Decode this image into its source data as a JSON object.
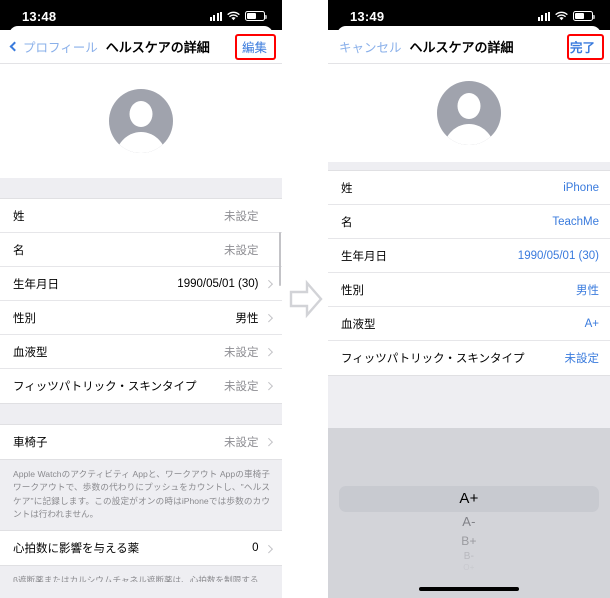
{
  "left_phone": {
    "status": {
      "time": "13:48",
      "cellular_icon": "signal-bars-icon",
      "wifi_icon": "wifi-icon",
      "battery_icon": "battery-icon"
    },
    "nav": {
      "back_label": "プロフィール",
      "title": "ヘルスケアの詳細",
      "action_label": "編集",
      "highlight_color": "#ff0000"
    },
    "avatar": "person-avatar-icon",
    "sections": [
      {
        "rows": [
          {
            "label": "姓",
            "value": "未設定",
            "value_style": "muted",
            "chevron": false
          },
          {
            "label": "名",
            "value": "未設定",
            "value_style": "muted",
            "chevron": false
          },
          {
            "label": "生年月日",
            "value": "1990/05/01 (30)",
            "value_style": "dark",
            "chevron": true
          },
          {
            "label": "性別",
            "value": "男性",
            "value_style": "dark",
            "chevron": true
          },
          {
            "label": "血液型",
            "value": "未設定",
            "value_style": "muted",
            "chevron": true
          },
          {
            "label": "フィッツパトリック・スキンタイプ",
            "value": "未設定",
            "value_style": "muted",
            "chevron": true
          }
        ]
      },
      {
        "rows": [
          {
            "label": "車椅子",
            "value": "未設定",
            "value_style": "muted",
            "chevron": true
          }
        ],
        "footnote": "Apple Watchのアクティビティ Appと、ワークアウト Appの車椅子ワークアウトで、歩数の代わりにプッシュをカウントし、\"ヘルスケア\"に記録します。この設定がオンの時はiPhoneでは歩数のカウントは行われません。"
      },
      {
        "rows": [
          {
            "label": "心拍数に影響を与える薬",
            "value": "0",
            "value_style": "dark",
            "chevron": true
          }
        ],
        "footnote": "β遮断薬またはカルシウムチャネル遮断薬は、心拍数を制限する"
      }
    ]
  },
  "right_phone": {
    "status": {
      "time": "13:49",
      "cellular_icon": "signal-bars-icon",
      "wifi_icon": "wifi-icon",
      "battery_icon": "battery-icon"
    },
    "nav": {
      "cancel_label": "キャンセル",
      "title": "ヘルスケアの詳細",
      "action_label": "完了",
      "highlight_color": "#ff0000"
    },
    "avatar": "person-avatar-icon",
    "sections": [
      {
        "rows": [
          {
            "label": "姓",
            "value": "iPhone",
            "value_style": "blue",
            "chevron": false
          },
          {
            "label": "名",
            "value": "TeachMe",
            "value_style": "blue",
            "chevron": false
          },
          {
            "label": "生年月日",
            "value": "1990/05/01 (30)",
            "value_style": "blue",
            "chevron": false
          },
          {
            "label": "性別",
            "value": "男性",
            "value_style": "blue",
            "chevron": false
          },
          {
            "label": "血液型",
            "value": "A+",
            "value_style": "blue",
            "chevron": false
          },
          {
            "label": "フィッツパトリック・スキンタイプ",
            "value": "未設定",
            "value_style": "blue",
            "chevron": false
          }
        ]
      }
    ],
    "picker": {
      "name": "blood-type-picker",
      "selected": "A+",
      "options_visible": [
        "A+",
        "A-",
        "B+",
        "B-",
        "O+"
      ]
    },
    "home_indicator": "home-indicator"
  },
  "transition_arrow": {
    "name": "right-arrow-icon",
    "color": "#d2d3d7"
  }
}
